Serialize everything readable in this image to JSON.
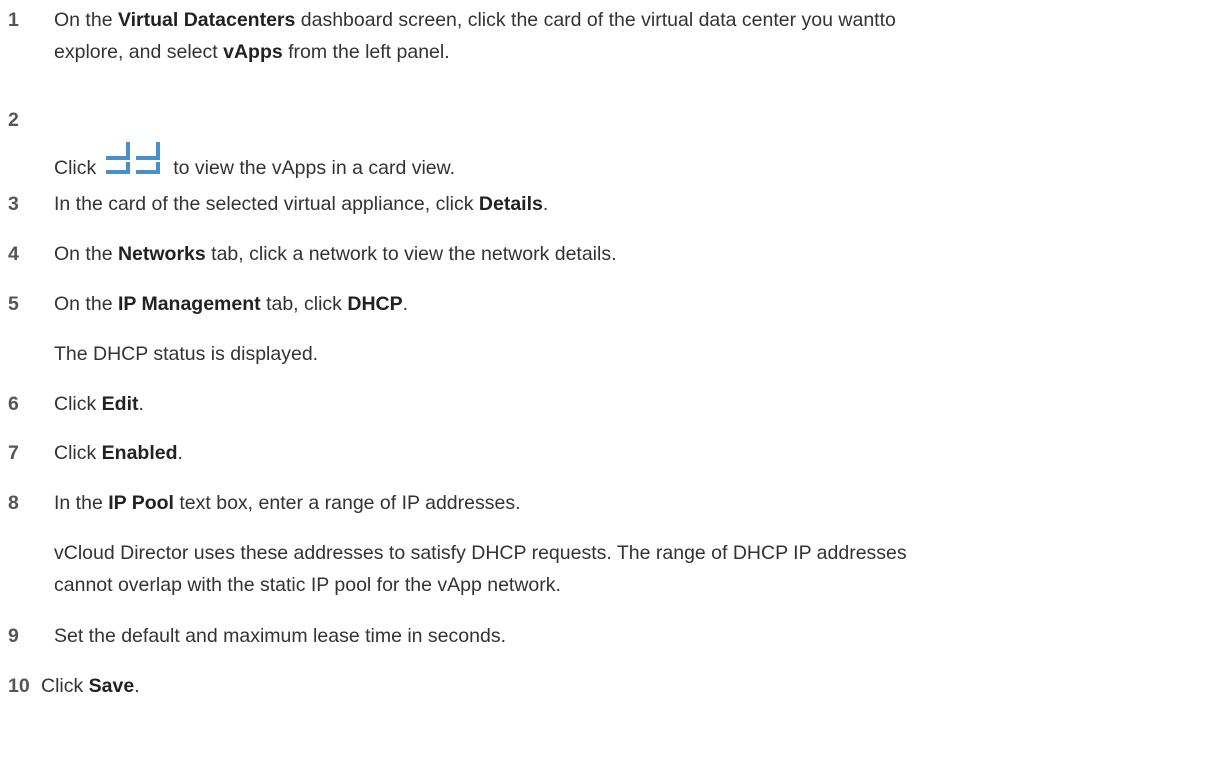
{
  "steps": [
    {
      "number": "1",
      "segments": [
        "On the ",
        "Virtual Datacenters",
        " dashboard screen, click the card of the virtual data center you want",
        "to",
        " ",
        "explore, and select ",
        "vApps",
        " from the left panel."
      ]
    },
    {
      "number": "2",
      "before": "Click",
      "icon": "card-view-icon",
      "after": "to view the vApps in a card view."
    },
    {
      "number": "3",
      "segments": [
        "In the card of the selected virtual appliance, click ",
        "Details",
        "."
      ]
    },
    {
      "number": "4",
      "segments": [
        "On the ",
        "Networks",
        " tab, click a network to view the network details."
      ]
    },
    {
      "number": "5",
      "segments": [
        "On the ",
        "IP Management",
        " tab, click ",
        "DHCP",
        "."
      ],
      "note": "The DHCP status is displayed."
    },
    {
      "number": "6",
      "segments": [
        "Click ",
        "Edit",
        "."
      ]
    },
    {
      "number": "7",
      "segments": [
        "Click ",
        "Enabled",
        "."
      ]
    },
    {
      "number": "8",
      "segments": [
        "In the ",
        "IP Pool",
        " text box, enter a range of IP addresses."
      ],
      "note_line1": "vCloud Director uses these addresses to satisfy DHCP requests. The range of DHCP IP addresses",
      "note_line2": "cannot overlap with the static IP pool for the vApp network."
    },
    {
      "number": "9",
      "text": "Set the default and maximum lease time in seconds."
    },
    {
      "number": "10",
      "segments": [
        "Click ",
        "Save",
        "."
      ]
    }
  ],
  "colors": {
    "text": "#333333",
    "number": "#555555",
    "icon": "#4a90c8"
  }
}
